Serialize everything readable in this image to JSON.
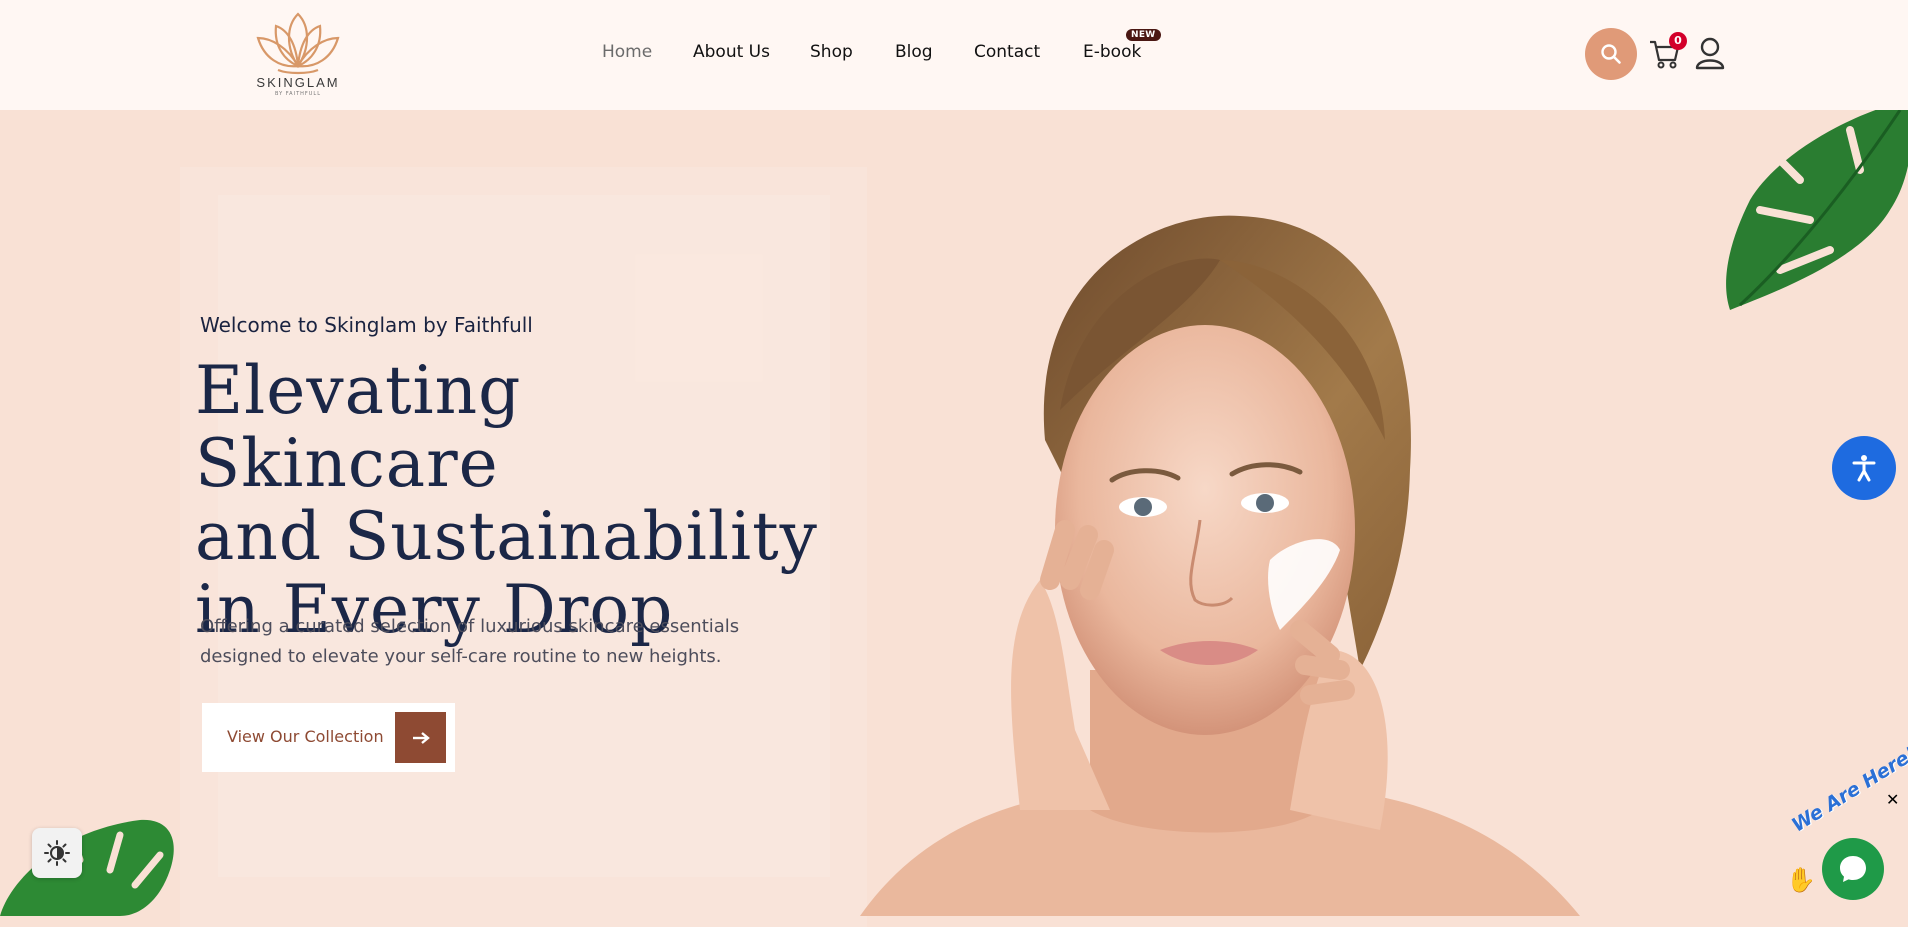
{
  "brand": {
    "name": "SKINGLAM",
    "sub": "BY FAITHFULL"
  },
  "nav": {
    "items": [
      {
        "label": "Home",
        "active": true
      },
      {
        "label": "About Us"
      },
      {
        "label": "Shop"
      },
      {
        "label": "Blog"
      },
      {
        "label": "Contact"
      },
      {
        "label": "E-book"
      }
    ],
    "badge": "NEW"
  },
  "header": {
    "cart_count": "0"
  },
  "hero": {
    "welcome": "Welcome to Skinglam by Faithfull",
    "headline": [
      "Elevating Skincare",
      "and Sustainability",
      "in Every Drop"
    ],
    "description": "Offering a curated selection of luxurious skincare essentials designed to elevate your self-care routine to new heights.",
    "cta_label": "View Our Collection"
  },
  "chat": {
    "tagline": "We Are Here!",
    "close": "✕"
  },
  "icons": [
    "lotus-logo-icon",
    "search-icon",
    "cart-icon",
    "user-icon",
    "arrow-right-icon",
    "accessibility-icon",
    "contrast-icon",
    "chat-icon",
    "close-icon",
    "hand-icon"
  ],
  "colors": {
    "accent": "#e09a78",
    "cta": "#8e4a33",
    "hero_bg": "#f9e1d5",
    "header_bg": "#fff7f3",
    "headline": "#1b2747",
    "a11y": "#1e6be0",
    "chat": "#1f9a48"
  }
}
